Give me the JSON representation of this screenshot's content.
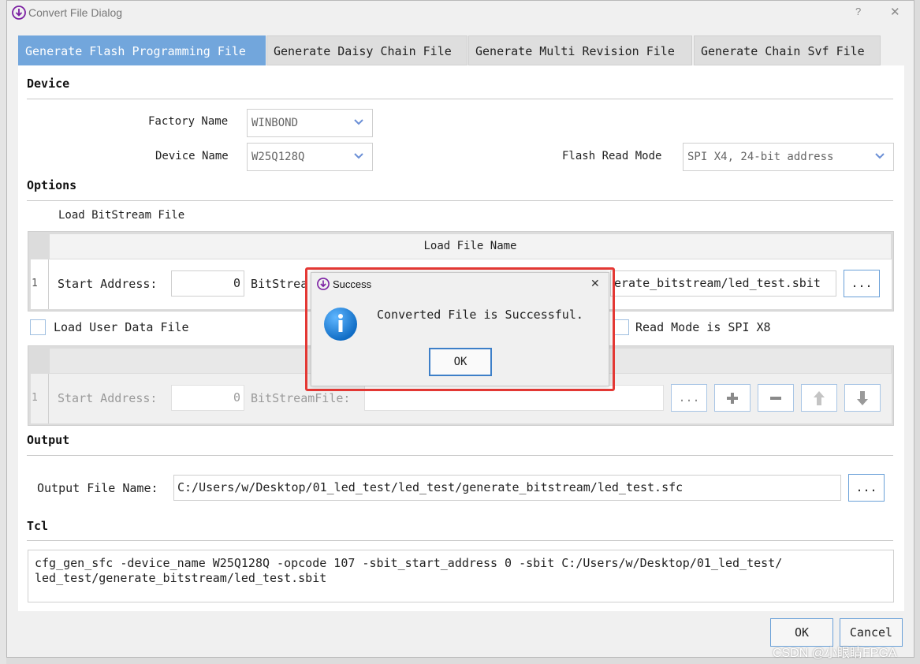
{
  "window": {
    "title": "Convert File Dialog",
    "help": "?",
    "close": "✕"
  },
  "tabs": [
    {
      "label": "Generate Flash Programming File",
      "active": true
    },
    {
      "label": "Generate Daisy Chain File"
    },
    {
      "label": "Generate Multi Revision File"
    },
    {
      "label": "Generate Chain Svf File"
    }
  ],
  "device": {
    "section": "Device",
    "factory_label": "Factory Name",
    "factory_value": "WINBOND",
    "device_label": "Device Name",
    "device_value": "W25Q128Q",
    "read_mode_label": "Flash Read Mode",
    "read_mode_value": "SPI X4, 24-bit address"
  },
  "options": {
    "section": "Options",
    "load_bitstream_label": "Load BitStream File",
    "table_header": "Load File Name",
    "row_index": "1",
    "start_address_label": "Start Address:",
    "start_address_value": "0",
    "bitstream_label_partial": "BitStrea",
    "bitstream_value_partial": "erate_bitstream/led_test.sbit",
    "browse": "...",
    "load_user_data_label": "Load User Data File",
    "read_mode_x8_label": "Read Mode is SPI X8",
    "user_row_index": "1",
    "user_start_address_label": "Start Address:",
    "user_start_address_value": "0",
    "user_bitstream_label": "BitStreamFile:",
    "user_bitstream_value": ""
  },
  "output": {
    "section": "Output",
    "file_name_label": "Output File Name:",
    "file_name_value": "C:/Users/w/Desktop/01_led_test/led_test/generate_bitstream/led_test.sfc",
    "browse": "..."
  },
  "tcl": {
    "section": "Tcl",
    "line1": "cfg_gen_sfc -device_name W25Q128Q -opcode 107 -sbit_start_address 0 -sbit C:/Users/w/Desktop/01_led_test/",
    "line2": "led_test/generate_bitstream/led_test.sbit"
  },
  "footer": {
    "ok": "OK",
    "cancel": "Cancel"
  },
  "popup": {
    "title": "Success",
    "message": "Converted File is Successful.",
    "ok": "OK",
    "close": "✕"
  },
  "watermark": "CSDN @小眼睛FPGA",
  "colors": {
    "accent": "#72a6dc",
    "highlight": "#e53935",
    "info": "#1a7fd4",
    "app_icon": "#7b1fa2"
  }
}
